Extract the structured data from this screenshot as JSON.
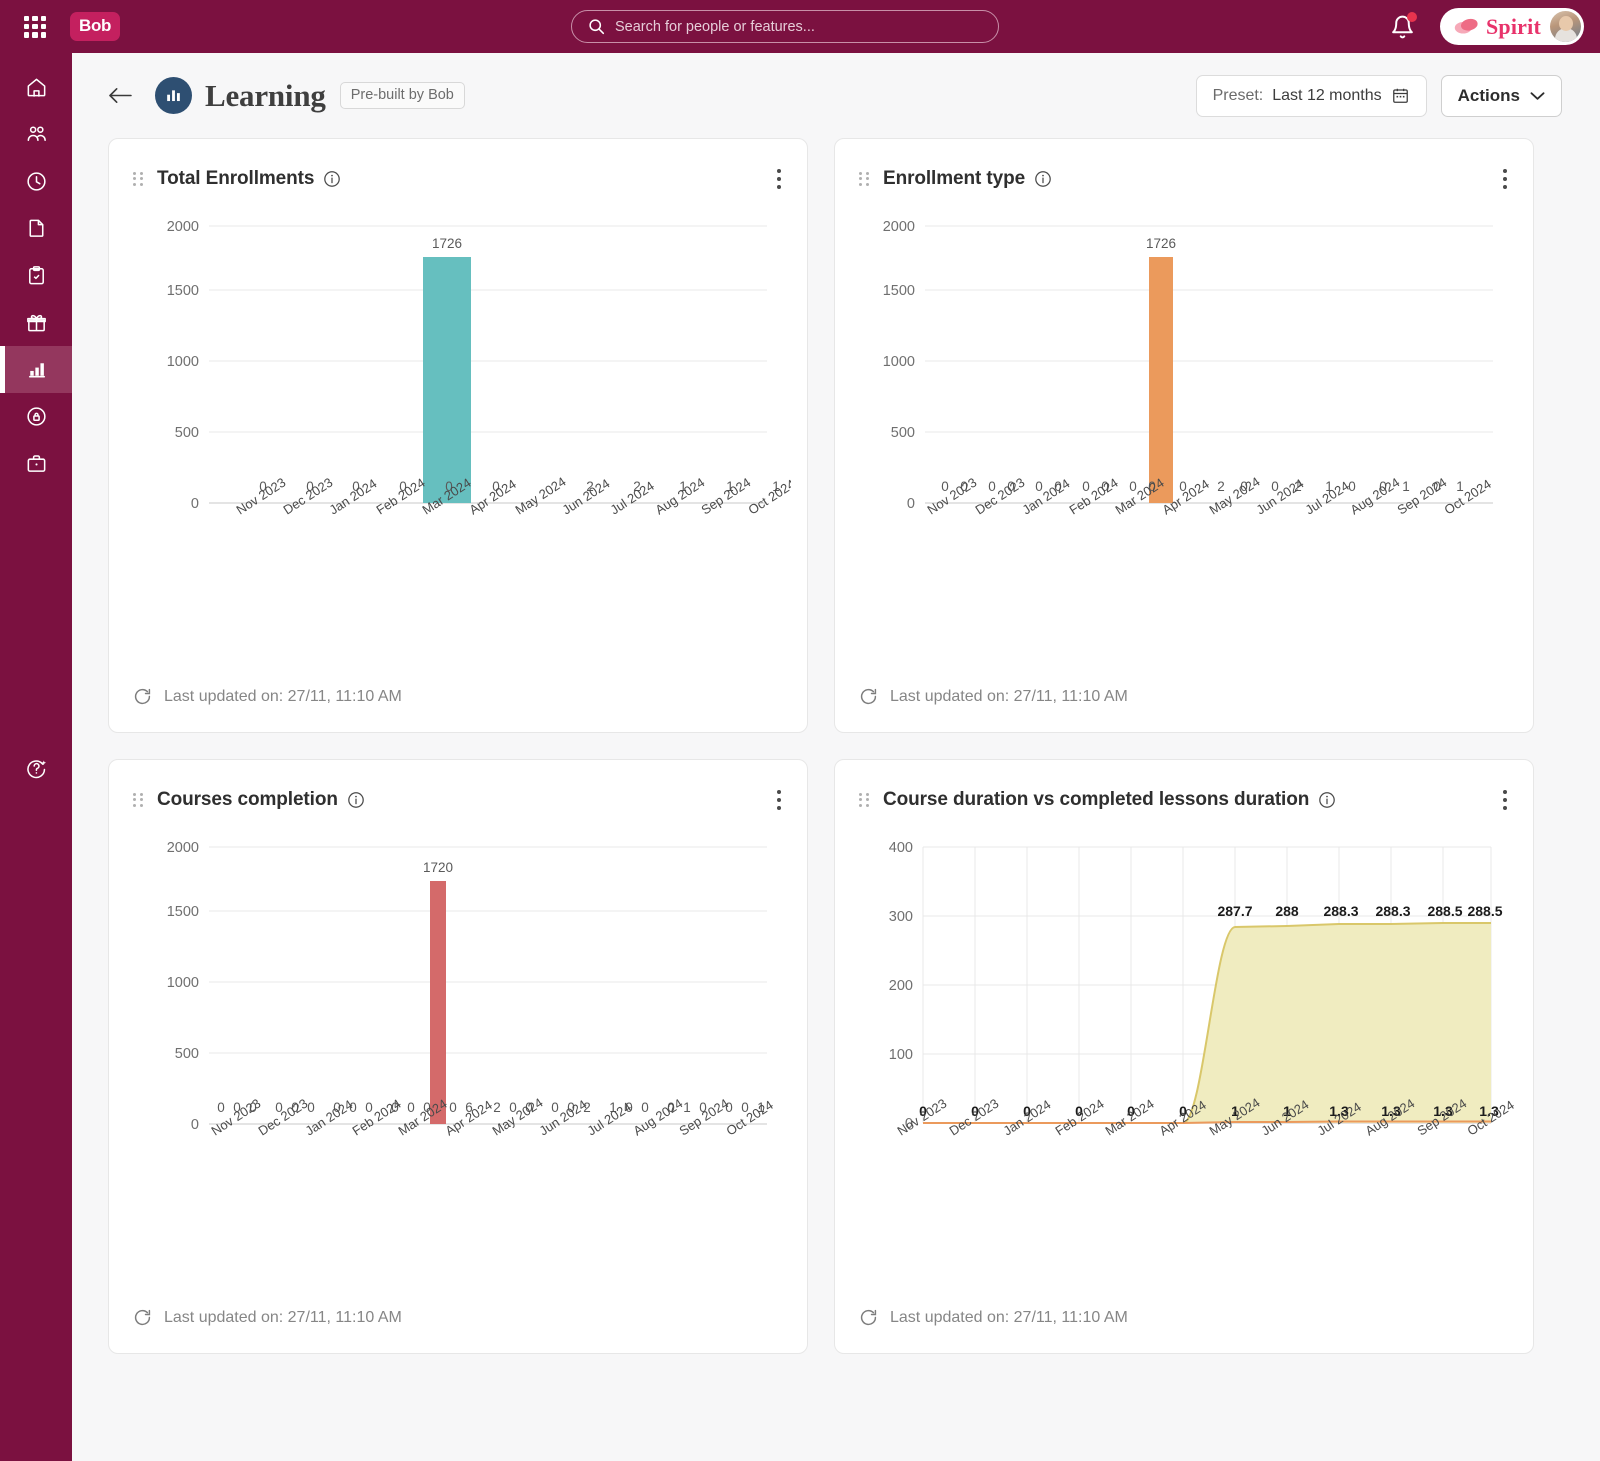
{
  "topbar": {
    "apps_icon": "grid-apps-icon",
    "logo_text": "Bob",
    "search_placeholder": "Search for people or features...",
    "search_value": "",
    "search_icon": "search-icon",
    "bell_icon": "notification-bell-icon",
    "account_name": "Spirit",
    "avatar_alt": "user-avatar"
  },
  "sidebar": {
    "items": [
      {
        "name": "home",
        "icon": "home-icon",
        "active": false
      },
      {
        "name": "people",
        "icon": "people-icon",
        "active": false
      },
      {
        "name": "time",
        "icon": "clock-icon",
        "active": false
      },
      {
        "name": "documents",
        "icon": "document-icon",
        "active": false
      },
      {
        "name": "tasks",
        "icon": "clipboard-check-icon",
        "active": false
      },
      {
        "name": "benefits",
        "icon": "gift-icon",
        "active": false
      },
      {
        "name": "analytics",
        "icon": "bar-chart-icon",
        "active": true
      },
      {
        "name": "compensation",
        "icon": "lock-shield-icon",
        "active": false
      },
      {
        "name": "hiring",
        "icon": "briefcase-icon",
        "active": false
      }
    ],
    "help": {
      "name": "help",
      "icon": "help-sparkle-icon"
    }
  },
  "header": {
    "back_icon": "back-arrow-icon",
    "title_icon": "bar-chart-circle-icon",
    "title": "Learning",
    "badge": "Pre-built by Bob",
    "preset_label": "Preset:",
    "preset_value": "Last 12 months",
    "calendar_icon": "calendar-icon",
    "actions_label": "Actions",
    "chevron_icon": "chevron-down-icon"
  },
  "cards": [
    {
      "title": "Total Enrollments",
      "info_icon": "info-icon",
      "menu_icon": "kebab-menu-icon",
      "refresh_icon": "refresh-icon",
      "footer": "Last updated on: 27/11, 11:10 AM"
    },
    {
      "title": "Enrollment type",
      "info_icon": "info-icon",
      "menu_icon": "kebab-menu-icon",
      "refresh_icon": "refresh-icon",
      "footer": "Last updated on: 27/11, 11:10 AM"
    },
    {
      "title": "Courses completion",
      "info_icon": "info-icon",
      "menu_icon": "kebab-menu-icon",
      "refresh_icon": "refresh-icon",
      "footer": "Last updated on: 27/11, 11:10 AM"
    },
    {
      "title": "Course duration vs completed lessons duration",
      "info_icon": "info-icon",
      "menu_icon": "kebab-menu-icon",
      "refresh_icon": "refresh-icon",
      "footer": "Last updated on: 27/11, 11:10 AM"
    }
  ],
  "colors": {
    "brand": "#7b1140",
    "teal": "#66bfbf",
    "orange": "#eb9a5c",
    "red": "#d46a6a",
    "yellow_fill": "#f0ecc0",
    "yellow_line": "#d9c76a"
  },
  "chart_data": [
    {
      "type": "bar",
      "title": "Total Enrollments",
      "categories": [
        "Nov 2023",
        "Dec 2023",
        "Jan 2024",
        "Feb 2024",
        "Mar 2024",
        "Apr 2024",
        "May 2024",
        "Jun 2024",
        "Jul 2024",
        "Aug 2024",
        "Sep 2024",
        "Oct 2024"
      ],
      "values": [
        0,
        0,
        0,
        0,
        0,
        0,
        1726,
        2,
        2,
        1,
        1,
        1
      ],
      "labels": [
        "0",
        "0",
        "0",
        "0",
        "0",
        "0",
        "1726",
        "2",
        "2",
        "1",
        "1",
        "1"
      ],
      "color": "#66bfbf",
      "xlabel": "",
      "ylabel": "",
      "ylim": [
        0,
        2000
      ],
      "yticks": [
        0,
        500,
        1000,
        1500,
        2000
      ],
      "grid": true,
      "legend": "none"
    },
    {
      "type": "bar",
      "title": "Enrollment type",
      "categories": [
        "Nov 2023",
        "Dec 2023",
        "Jan 2024",
        "Feb 2024",
        "Mar 2024",
        "Apr 2024",
        "May 2024",
        "Jun 2024",
        "Jul 2024",
        "Aug 2024",
        "Sep 2024",
        "Oct 2024"
      ],
      "series": [
        {
          "name": "series-1",
          "values": [
            0,
            0,
            0,
            0,
            0,
            0,
            1726,
            0,
            0,
            1,
            0,
            0
          ]
        },
        {
          "name": "series-2",
          "values": [
            0,
            0,
            0,
            0,
            0,
            0,
            0,
            2,
            2,
            0,
            1,
            1
          ]
        }
      ],
      "group_labels": [
        [
          "0",
          "0"
        ],
        [
          "0",
          "0"
        ],
        [
          "0",
          "0"
        ],
        [
          "0",
          "0"
        ],
        [
          "0",
          "0"
        ],
        [
          "0",
          "0"
        ],
        [
          "1726",
          "0"
        ],
        [
          "2",
          "0"
        ],
        [
          "0",
          "2"
        ],
        [
          "1",
          "0"
        ],
        [
          "0",
          "1"
        ],
        [
          "0",
          "1"
        ]
      ],
      "color": "#eb9a5c",
      "xlabel": "",
      "ylabel": "",
      "ylim": [
        0,
        2000
      ],
      "yticks": [
        0,
        500,
        1000,
        1500,
        2000
      ],
      "grid": true,
      "legend": "none"
    },
    {
      "type": "bar",
      "title": "Courses completion",
      "categories": [
        "Nov 2023",
        "Dec 2023",
        "Jan 2024",
        "Feb 2024",
        "Mar 2024",
        "Apr 2024",
        "May 2024",
        "Jun 2024",
        "Jul 2024",
        "Aug 2024",
        "Sep 2024",
        "Oct 2024"
      ],
      "group_labels": [
        [
          "0",
          "0",
          "0"
        ],
        [
          "0",
          "0",
          "0"
        ],
        [
          "0",
          "0",
          "0"
        ],
        [
          "0",
          "0",
          "0"
        ],
        [
          "0",
          "0",
          "0"
        ],
        [
          "0",
          "0",
          "0"
        ],
        [
          "1720",
          "0",
          "6"
        ],
        [
          "2",
          "0",
          "0"
        ],
        [
          "0",
          "0",
          "2"
        ],
        [
          "1",
          "0",
          "0"
        ],
        [
          "0",
          "1",
          "0"
        ],
        [
          "0",
          "0",
          "1"
        ]
      ],
      "highlight_value": 1720,
      "highlight_index": 6,
      "color": "#d46a6a",
      "xlabel": "",
      "ylabel": "",
      "ylim": [
        0,
        2000
      ],
      "yticks": [
        0,
        500,
        1000,
        1500,
        2000
      ],
      "grid": true,
      "legend": "none"
    },
    {
      "type": "area",
      "title": "Course duration vs completed lessons duration",
      "categories": [
        "Nov 2023",
        "Dec 2023",
        "Jan 2024",
        "Feb 2024",
        "Mar 2024",
        "Apr 2024",
        "May 2024",
        "Jun 2024",
        "Jul 2024",
        "Aug 2024",
        "Sep 2024",
        "Oct 2024"
      ],
      "series": [
        {
          "name": "course-duration",
          "values": [
            0,
            0,
            0,
            0,
            0,
            0,
            287.7,
            288,
            288.3,
            288.3,
            288.5,
            288.5
          ],
          "labels": [
            "",
            "",
            "",
            "",
            "",
            "",
            "287.7",
            "288",
            "288.3",
            "288.3",
            "288.5",
            "288.5"
          ]
        },
        {
          "name": "completed-lessons-duration",
          "values": [
            0,
            0,
            0,
            0,
            0,
            0,
            1,
            1,
            1.3,
            1.3,
            1.3,
            1.3
          ],
          "labels": [
            "0",
            "0",
            "0",
            "0",
            "0",
            "0",
            "1",
            "1",
            "1.3",
            "1.3",
            "1.3",
            "1.3"
          ]
        }
      ],
      "xlabel": "",
      "ylabel": "",
      "ylim": [
        0,
        400
      ],
      "yticks": [
        0,
        100,
        200,
        300,
        400
      ],
      "grid": true,
      "legend": "none"
    }
  ]
}
